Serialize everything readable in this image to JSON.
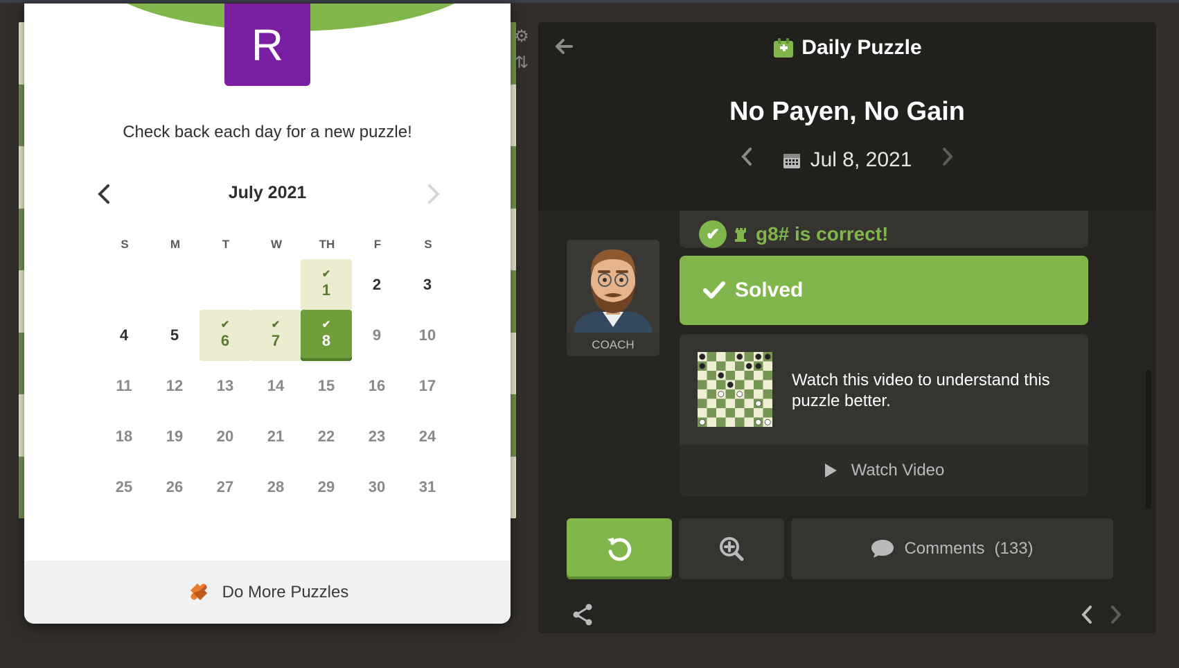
{
  "popup": {
    "avatar_letter": "R",
    "message": "Check back each day for a new puzzle!",
    "month_label": "July 2021",
    "weekdays": [
      "S",
      "M",
      "T",
      "W",
      "TH",
      "F",
      "S"
    ],
    "days": [
      "1",
      "2",
      "3",
      "4",
      "5",
      "6",
      "7",
      "8",
      "9",
      "10",
      "11",
      "12",
      "13",
      "14",
      "15",
      "16",
      "17",
      "18",
      "19",
      "20",
      "21",
      "22",
      "23",
      "24",
      "25",
      "26",
      "27",
      "28",
      "29",
      "30",
      "31"
    ],
    "footer_label": "Do More Puzzles"
  },
  "panel": {
    "title": "Daily Puzzle",
    "puzzle_name": "No Payen, No Gain",
    "date": "Jul 8, 2021",
    "correct_move": "g8# is correct!",
    "coach_label": "COACH",
    "solved_label": "Solved",
    "video_text": "Watch this video to understand this puzzle better.",
    "watch_label": "Watch Video",
    "comments_label": "Comments",
    "comments_count": "(133)"
  },
  "colors": {
    "accent_green": "#81b64c",
    "avatar_purple": "#7b1fa2",
    "panel_bg": "#262421"
  }
}
